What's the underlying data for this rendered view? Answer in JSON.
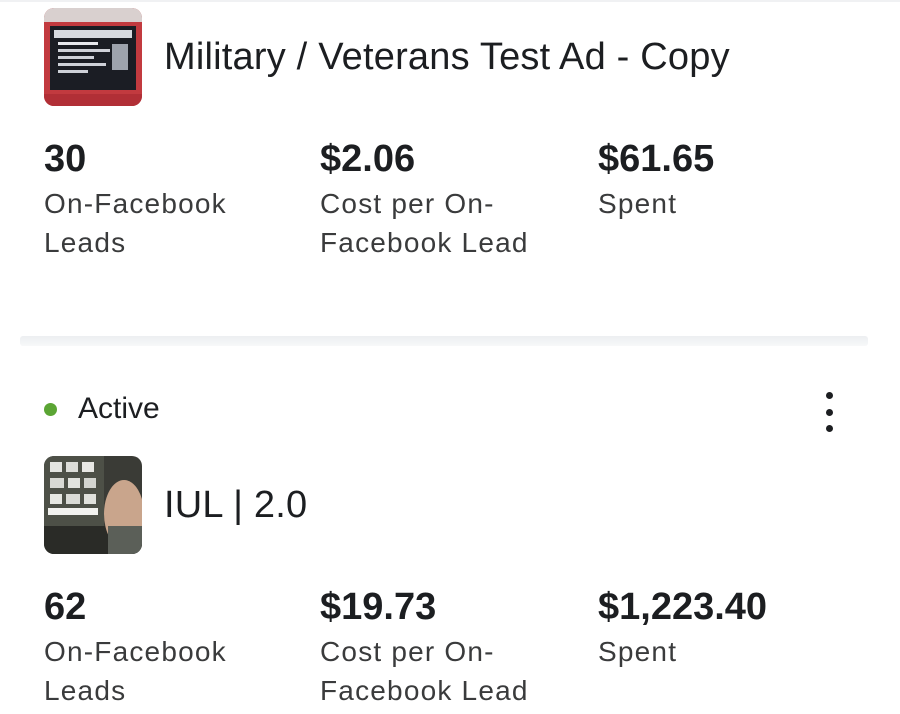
{
  "ads": [
    {
      "title": "Military / Veterans Test Ad - Copy",
      "metrics": [
        {
          "value": "30",
          "label": "On-Facebook Leads"
        },
        {
          "value": "$2.06",
          "label": "Cost per On-Facebook Lead"
        },
        {
          "value": "$61.65",
          "label": "Spent"
        }
      ]
    },
    {
      "status": "Active",
      "status_color": "#5ba534",
      "menu_icon": "more-vertical-icon",
      "title": "IUL | 2.0",
      "metrics": [
        {
          "value": "62",
          "label": "On-Facebook Leads"
        },
        {
          "value": "$19.73",
          "label": "Cost per On-Facebook Lead"
        },
        {
          "value": "$1,223.40",
          "label": "Spent"
        }
      ]
    }
  ]
}
